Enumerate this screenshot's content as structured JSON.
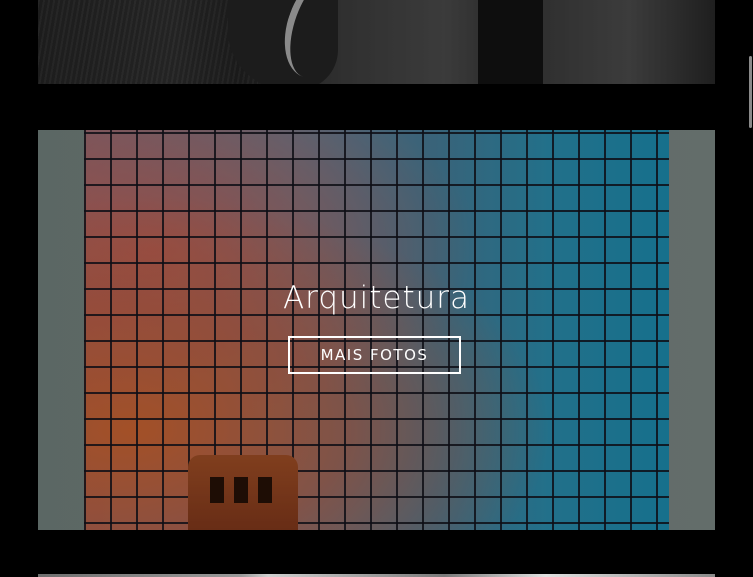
{
  "gallery": {
    "top_card": {
      "image": "elephant-photo"
    },
    "main_card": {
      "image": "architecture-photo",
      "title": "Arquitetura",
      "button_label": "MAIS FOTOS"
    },
    "bottom_card": {
      "image": "next-gallery-photo"
    }
  },
  "colors": {
    "background": "#000000",
    "text": "#ffffff",
    "button_border": "#ffffff"
  }
}
